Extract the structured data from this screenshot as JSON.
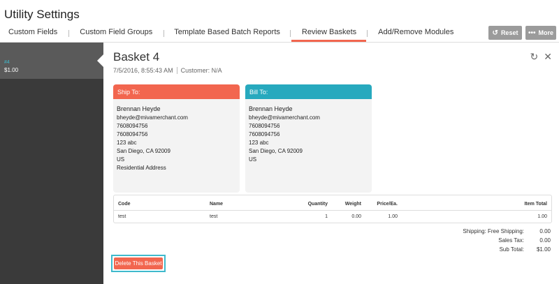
{
  "app": {
    "title": "Utility Settings"
  },
  "tabs": [
    {
      "label": "Custom Fields"
    },
    {
      "label": "Custom Field Groups"
    },
    {
      "label": "Template Based Batch Reports"
    },
    {
      "label": "Review Baskets"
    },
    {
      "label": "Add/Remove Modules"
    }
  ],
  "header_buttons": {
    "reset": "Reset",
    "more": "More"
  },
  "sidebar": {
    "items": [
      {
        "id": "#4",
        "amount": "$1.00"
      }
    ]
  },
  "basket": {
    "title": "Basket 4",
    "date": "7/5/2016, 8:55:43 AM",
    "customer": "Customer: N/A"
  },
  "ship_to": {
    "header": "Ship To:",
    "color": "#f2664f",
    "name": "Brennan Heyde",
    "email": "bheyde@mivamerchant.com",
    "phone": "7608094756",
    "fax": "7608094756",
    "address": "123 abc",
    "city_state_zip": "San Diego, CA 92009",
    "country": "US",
    "residential": "Residential Address"
  },
  "bill_to": {
    "header": "Bill To:",
    "color": "#27a9be",
    "name": "Brennan Heyde",
    "email": "bheyde@mivamerchant.com",
    "phone": "7608094756",
    "fax": "7608094756",
    "address": "123 abc",
    "city_state_zip": "San Diego, CA 92009",
    "country": "US"
  },
  "items": {
    "headers": {
      "code": "Code",
      "name": "Name",
      "quantity": "Quantity",
      "weight": "Weight",
      "price": "Price/Ea.",
      "total": "Item Total"
    },
    "rows": [
      {
        "code": "test",
        "name": "test",
        "quantity": "1",
        "weight": "0.00",
        "price": "1.00",
        "total": "1.00"
      }
    ]
  },
  "totals": {
    "shipping_label": "Shipping: Free Shipping:",
    "shipping_value": "0.00",
    "tax_label": "Sales Tax:",
    "tax_value": "0.00",
    "subtotal_label": "Sub Total:",
    "subtotal_value": "$1.00"
  },
  "actions": {
    "delete": "Delete This Basket"
  },
  "icons": {
    "refresh": "refresh-icon",
    "close": "close-icon",
    "reset": "reset-icon",
    "more": "more-icon"
  },
  "colors": {
    "accent": "#f2664f",
    "teal": "#27a9be"
  }
}
